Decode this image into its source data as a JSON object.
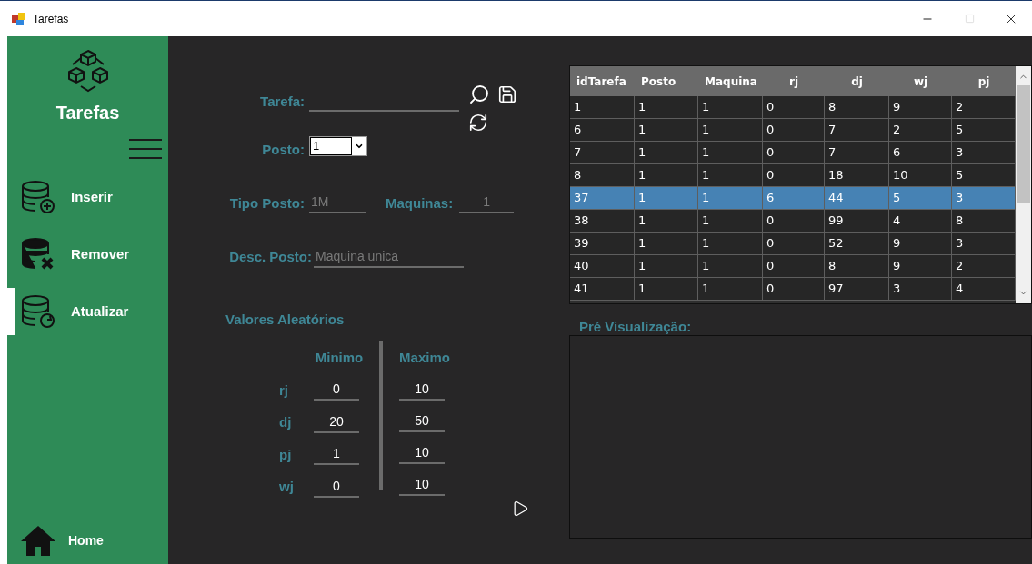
{
  "window": {
    "title": "Tarefas"
  },
  "sidebar": {
    "title": "Tarefas",
    "items": [
      {
        "kind": "insert",
        "label": "Inserir",
        "selected": false
      },
      {
        "kind": "remove",
        "label": "Remover",
        "selected": false
      },
      {
        "kind": "update",
        "label": "Atualizar",
        "selected": true
      }
    ],
    "home": "Home"
  },
  "form": {
    "tarefa": {
      "label": "Tarefa:"
    },
    "posto": {
      "label": "Posto:",
      "value": "1"
    },
    "tipo_posto": {
      "label": "Tipo Posto:",
      "value": "1M"
    },
    "maquinas": {
      "label": "Maquinas:",
      "value": "1"
    },
    "desc_posto": {
      "label": "Desc. Posto:",
      "value": "Maquina unica"
    }
  },
  "random_values": {
    "title": "Valores Aleatórios",
    "min_header": "Minimo",
    "max_header": "Maximo",
    "rows": [
      {
        "label": "rj",
        "min": "0",
        "max": "10"
      },
      {
        "label": "dj",
        "min": "20",
        "max": "50"
      },
      {
        "label": "pj",
        "min": "1",
        "max": "10"
      },
      {
        "label": "wj",
        "min": "0",
        "max": "10"
      }
    ]
  },
  "table": {
    "columns": [
      "idTarefa",
      "Posto",
      "Maquina",
      "rj",
      "dj",
      "wj",
      "pj"
    ],
    "rows": [
      {
        "cells": [
          "1",
          "1",
          "1",
          "0",
          "8",
          "9",
          "2"
        ],
        "selected": false
      },
      {
        "cells": [
          "6",
          "1",
          "1",
          "0",
          "7",
          "2",
          "5"
        ],
        "selected": false
      },
      {
        "cells": [
          "7",
          "1",
          "1",
          "0",
          "7",
          "6",
          "3"
        ],
        "selected": false
      },
      {
        "cells": [
          "8",
          "1",
          "1",
          "0",
          "18",
          "10",
          "5"
        ],
        "selected": false
      },
      {
        "cells": [
          "37",
          "1",
          "1",
          "6",
          "44",
          "5",
          "3"
        ],
        "selected": true
      },
      {
        "cells": [
          "38",
          "1",
          "1",
          "0",
          "99",
          "4",
          "8"
        ],
        "selected": false
      },
      {
        "cells": [
          "39",
          "1",
          "1",
          "0",
          "52",
          "9",
          "3"
        ],
        "selected": false
      },
      {
        "cells": [
          "40",
          "1",
          "1",
          "0",
          "8",
          "9",
          "2"
        ],
        "selected": false
      },
      {
        "cells": [
          "41",
          "1",
          "1",
          "0",
          "97",
          "3",
          "4"
        ],
        "selected": false
      }
    ]
  },
  "preview": {
    "label": "Pré Visualização:"
  }
}
